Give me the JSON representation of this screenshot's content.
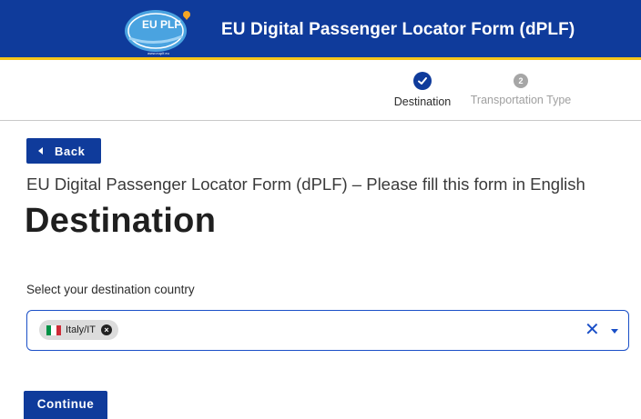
{
  "header": {
    "logo_text": "EU PLF",
    "logo_url_text": "www.euplf.eu",
    "title": "EU Digital Passenger Locator Form (dPLF)",
    "brand_color": "#0f3b9b",
    "accent_color": "#f5c518"
  },
  "stepper": {
    "steps": [
      {
        "label": "Destination",
        "status": "completed",
        "icon": "check-icon"
      },
      {
        "label": "Transportation Type",
        "status": "pending",
        "number": "2"
      }
    ]
  },
  "back_button": {
    "label": "Back",
    "icon": "caret-left-icon"
  },
  "subtitle": "EU Digital Passenger Locator Form (dPLF) – Please fill this form in English",
  "page_title": "Destination",
  "destination_field": {
    "label": "Select your destination country",
    "selected": [
      {
        "text": "Italy/IT",
        "flag": "italy-flag"
      }
    ]
  },
  "continue_button": {
    "label": "Continue"
  }
}
